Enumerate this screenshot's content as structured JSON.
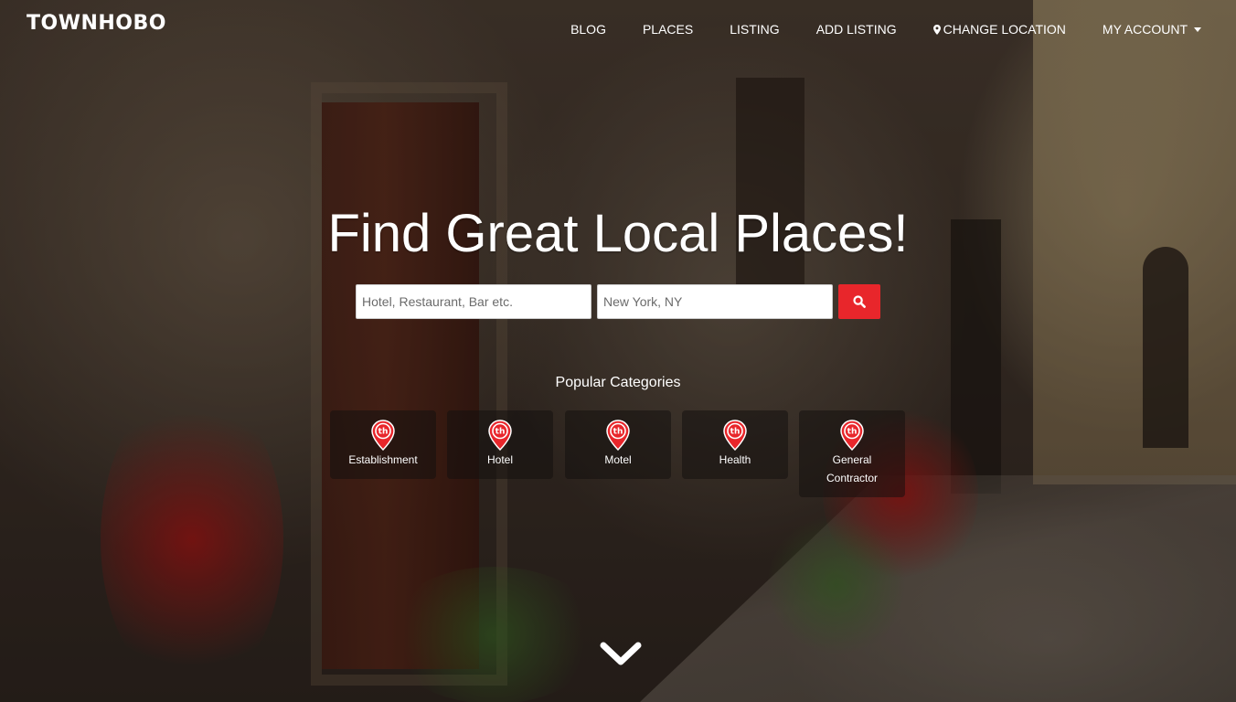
{
  "brand": {
    "name": "TOWNHOBO"
  },
  "nav": {
    "blog": "BLOG",
    "places": "PLACES",
    "listing": "LISTING",
    "add_listing": "ADD LISTING",
    "change_location": "CHANGE LOCATION",
    "my_account": "MY ACCOUNT"
  },
  "hero": {
    "headline": "Find Great Local Places!"
  },
  "search": {
    "what_placeholder": "Hotel, Restaurant, Bar etc.",
    "where_placeholder": "New York, NY",
    "button_icon": "search-icon"
  },
  "categories": {
    "title": "Popular Categories",
    "items": [
      {
        "label": "Establishment",
        "icon": "location-pin-icon"
      },
      {
        "label": "Hotel",
        "icon": "location-pin-icon"
      },
      {
        "label": "Motel",
        "icon": "location-pin-icon"
      },
      {
        "label": "Health",
        "icon": "location-pin-icon"
      },
      {
        "label": "General Contractor",
        "icon": "location-pin-icon"
      }
    ],
    "pin_text": "th"
  },
  "colors": {
    "accent": "#e8262b",
    "text": "#ffffff"
  }
}
